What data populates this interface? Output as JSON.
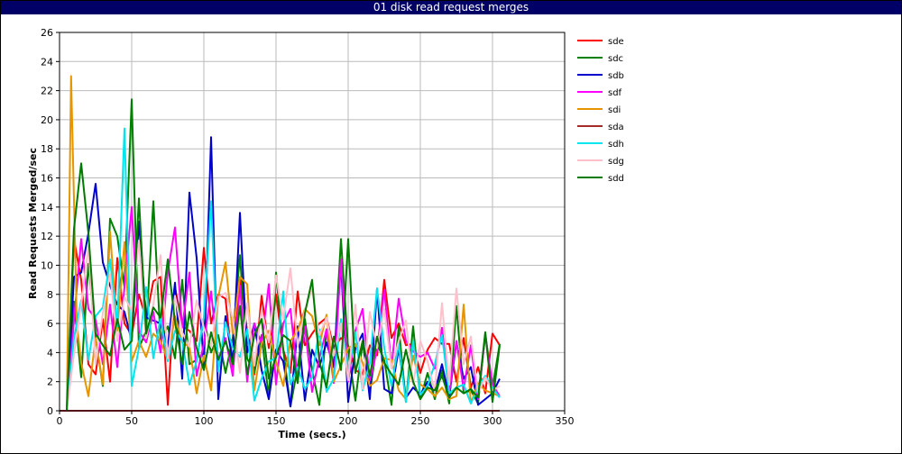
{
  "window": {
    "title": "01 disk read request merges"
  },
  "chart_data": {
    "type": "line",
    "title": "01 disk read request merges",
    "xlabel": "Time (secs.)",
    "ylabel": "Read Requests Merged/sec",
    "xlim": [
      0,
      350
    ],
    "ylim": [
      0,
      26
    ],
    "xticks": [
      0,
      50,
      100,
      150,
      200,
      250,
      300,
      350
    ],
    "yticks": [
      0,
      2,
      4,
      6,
      8,
      10,
      12,
      14,
      16,
      18,
      20,
      22,
      24,
      26
    ],
    "grid": true,
    "legend_position": "right",
    "series": [
      {
        "name": "sde",
        "color": "#ff0000",
        "x": [
          5,
          10,
          15,
          20,
          25,
          30,
          35,
          40,
          45,
          50,
          55,
          60,
          65,
          70,
          75,
          80,
          85,
          90,
          95,
          100,
          105,
          110,
          115,
          120,
          125,
          130,
          135,
          140,
          145,
          150,
          155,
          160,
          165,
          170,
          175,
          180,
          185,
          190,
          195,
          200,
          205,
          210,
          215,
          220,
          225,
          230,
          235,
          240,
          245,
          250,
          255,
          260,
          265,
          270,
          275,
          280,
          285,
          290,
          295,
          300,
          305
        ],
        "values": [
          0,
          11.8,
          9,
          3.2,
          2.5,
          6.3,
          2,
          10.5,
          6,
          5.2,
          8,
          6.3,
          8.9,
          9.2,
          0.4,
          8.5,
          5.8,
          5.5,
          4.8,
          11.2,
          6,
          8,
          7.7,
          3,
          9,
          5.5,
          2.5,
          7.9,
          4.3,
          8,
          4.2,
          2.6,
          8.2,
          4.5,
          5.3,
          6,
          6.4,
          4.3,
          5,
          4.5,
          2.8,
          2.5,
          4.5,
          3.8,
          9,
          5,
          6,
          4.5,
          4.6,
          2.6,
          4.2,
          5,
          4.6,
          4.6,
          2,
          5,
          1.6,
          3,
          1.2,
          5.3,
          4.5
        ]
      },
      {
        "name": "sdc",
        "color": "#008000",
        "x": [
          5,
          10,
          15,
          20,
          25,
          30,
          35,
          40,
          45,
          50,
          55,
          60,
          65,
          70,
          75,
          80,
          85,
          90,
          95,
          100,
          105,
          110,
          115,
          120,
          125,
          130,
          135,
          140,
          145,
          150,
          155,
          160,
          165,
          170,
          175,
          180,
          185,
          190,
          195,
          200,
          205,
          210,
          215,
          220,
          225,
          230,
          235,
          240,
          245,
          250,
          255,
          260,
          265,
          270,
          275,
          280,
          285,
          290,
          295,
          300,
          305
        ],
        "values": [
          0,
          7.5,
          2.3,
          10.1,
          5,
          1.7,
          13.2,
          12,
          8.5,
          21.4,
          4.3,
          5.5,
          14.4,
          4.8,
          5.8,
          3.6,
          9,
          3.2,
          3.5,
          6.3,
          4,
          5.2,
          2.6,
          5,
          10.7,
          3.6,
          2.6,
          5.2,
          0.9,
          9.5,
          4.2,
          0.3,
          3,
          6.3,
          2.8,
          0.4,
          5.6,
          3,
          11.8,
          4.2,
          0.7,
          4.7,
          1.3,
          4.6,
          3.5,
          0.4,
          5.8,
          0.6,
          5.8,
          0.8,
          2.6,
          0.8,
          2.8,
          0.5,
          7.2,
          1.2,
          1.4,
          0.5,
          5.3,
          1.6,
          4.6
        ]
      },
      {
        "name": "sdb",
        "color": "#0000cc",
        "x": [
          5,
          10,
          15,
          20,
          25,
          30,
          35,
          40,
          45,
          50,
          55,
          60,
          65,
          70,
          75,
          80,
          85,
          90,
          95,
          100,
          105,
          110,
          115,
          120,
          125,
          130,
          135,
          140,
          145,
          150,
          155,
          160,
          165,
          170,
          175,
          180,
          185,
          190,
          195,
          200,
          205,
          210,
          215,
          220,
          225,
          230,
          235,
          240,
          245,
          250,
          255,
          260,
          265,
          270,
          275,
          280,
          285,
          290,
          295,
          300,
          305
        ],
        "values": [
          0,
          9.2,
          9.5,
          12.2,
          15.6,
          10.2,
          8.6,
          7.3,
          6.8,
          4.8,
          13,
          6.4,
          6.2,
          6,
          4.4,
          8.8,
          2.2,
          15,
          10.5,
          3.1,
          18.8,
          0.8,
          6.5,
          3.3,
          13.6,
          4,
          6,
          2.8,
          0.8,
          4.2,
          3.4,
          0.3,
          5.8,
          0.7,
          4.2,
          3,
          4.7,
          3,
          10.1,
          0.6,
          4.3,
          5.3,
          0.8,
          8.4,
          1.5,
          1.2,
          4.3,
          0.9,
          1.6,
          1.1,
          2,
          1.3,
          3.2,
          1,
          4.7,
          2.2,
          3,
          0.4,
          0.8,
          1.2,
          2.2
        ]
      },
      {
        "name": "sdf",
        "color": "#ff00ff",
        "x": [
          5,
          10,
          15,
          20,
          25,
          30,
          35,
          40,
          45,
          50,
          55,
          60,
          65,
          70,
          75,
          80,
          85,
          90,
          95,
          100,
          105,
          110,
          115,
          120,
          125,
          130,
          135,
          140,
          145,
          150,
          155,
          160,
          165,
          170,
          175,
          180,
          185,
          190,
          195,
          200,
          205,
          210,
          215,
          220,
          225,
          230,
          235,
          240,
          245,
          250,
          255,
          260,
          265,
          270,
          275,
          280,
          285,
          290,
          295,
          300,
          305
        ],
        "values": [
          0,
          6.2,
          11.8,
          7,
          6.3,
          3.2,
          7.3,
          3,
          8.5,
          14,
          5.5,
          4.7,
          6.8,
          4,
          9.5,
          12.6,
          5.7,
          9.5,
          2.4,
          4.6,
          8.2,
          3.5,
          5,
          2.4,
          8.6,
          2,
          6,
          4.6,
          8.7,
          1.8,
          6,
          7,
          2.2,
          5.8,
          1.3,
          3.6,
          5.6,
          1.9,
          10.4,
          2,
          5.5,
          7,
          2.1,
          4.2,
          8.3,
          3,
          7.7,
          4.8,
          4.1,
          3.7,
          4,
          2.9,
          5.7,
          1.2,
          4.8,
          1.5,
          4.5,
          0.8,
          5.2,
          1.8,
          1
        ]
      },
      {
        "name": "sdi",
        "color": "#e69500",
        "x": [
          5,
          8,
          12,
          15,
          20,
          25,
          30,
          35,
          40,
          45,
          50,
          55,
          60,
          65,
          70,
          75,
          80,
          85,
          90,
          95,
          100,
          105,
          110,
          115,
          120,
          125,
          130,
          135,
          140,
          145,
          150,
          155,
          160,
          165,
          170,
          175,
          180,
          185,
          190,
          195,
          200,
          205,
          210,
          215,
          220,
          225,
          230,
          235,
          240,
          245,
          250,
          255,
          260,
          265,
          270,
          275,
          280,
          285,
          290,
          295,
          300,
          305
        ],
        "values": [
          0,
          23,
          6,
          3.3,
          1,
          5,
          1.8,
          12.3,
          5.5,
          11.6,
          3.4,
          4.8,
          3.7,
          5.3,
          4.8,
          3.5,
          6.5,
          4.7,
          4.4,
          1.2,
          3.8,
          1.4,
          7.8,
          10.2,
          5.3,
          9.2,
          8.7,
          1.4,
          4.6,
          5.5,
          3.4,
          1.7,
          4.8,
          5.5,
          7,
          6.5,
          4.5,
          6.6,
          2,
          3.1,
          4.3,
          4.6,
          3.3,
          1.7,
          2.1,
          3.6,
          3.5,
          1.4,
          0.8,
          3.8,
          1.8,
          1.5,
          1,
          1.6,
          0.8,
          1,
          7.3,
          0.5,
          1.9,
          1.4,
          1.2,
          1
        ]
      },
      {
        "name": "sda",
        "color": "#a52a2a",
        "x": [
          0,
          50,
          100,
          150,
          200,
          250,
          305
        ],
        "values": [
          0,
          0,
          0,
          0,
          0,
          0,
          0
        ]
      },
      {
        "name": "sdh",
        "color": "#00e5ee",
        "x": [
          5,
          10,
          15,
          20,
          25,
          30,
          35,
          40,
          45,
          50,
          55,
          60,
          65,
          70,
          75,
          80,
          85,
          90,
          95,
          100,
          105,
          110,
          115,
          120,
          125,
          130,
          135,
          140,
          145,
          150,
          155,
          160,
          165,
          170,
          175,
          180,
          185,
          190,
          195,
          200,
          205,
          210,
          215,
          220,
          225,
          230,
          235,
          240,
          245,
          250,
          255,
          260,
          265,
          270,
          275,
          280,
          285,
          290,
          295,
          300,
          305
        ],
        "values": [
          0,
          5,
          7.6,
          3.5,
          6.5,
          7.1,
          10.4,
          5.8,
          19.4,
          1.7,
          4.3,
          8.5,
          3.6,
          6.4,
          3.4,
          5.5,
          4.8,
          1.8,
          3.4,
          6.4,
          14.4,
          2.7,
          6.1,
          4.3,
          3.7,
          5.6,
          0.7,
          2.2,
          3.4,
          3.6,
          8.2,
          1.8,
          3,
          1.5,
          2.3,
          5.6,
          1.3,
          2.2,
          6.3,
          2.6,
          5.4,
          1.4,
          3.3,
          8.4,
          4.3,
          1.7,
          4.6,
          0.6,
          4.8,
          1.1,
          1.7,
          3.2,
          5.2,
          1.2,
          1.6,
          1.8,
          0.5,
          1.6,
          2.4,
          1.6,
          0.9
        ]
      },
      {
        "name": "sdg",
        "color": "#ffc0cb",
        "x": [
          5,
          10,
          15,
          20,
          25,
          30,
          35,
          40,
          45,
          50,
          55,
          60,
          65,
          70,
          75,
          80,
          85,
          90,
          95,
          100,
          105,
          110,
          115,
          120,
          125,
          130,
          135,
          140,
          145,
          150,
          155,
          160,
          165,
          170,
          175,
          180,
          185,
          190,
          195,
          200,
          205,
          210,
          215,
          220,
          225,
          230,
          235,
          240,
          245,
          250,
          255,
          260,
          265,
          270,
          275,
          280,
          285,
          290,
          295,
          300,
          305
        ],
        "values": [
          0,
          3.9,
          7.3,
          11.3,
          3.2,
          6.7,
          9.4,
          4.8,
          7.8,
          6.9,
          11.7,
          5,
          7.3,
          10.7,
          3.6,
          7.9,
          5.4,
          4.4,
          7.6,
          5.7,
          4.4,
          7.8,
          8.1,
          6.4,
          2.6,
          7.4,
          3.1,
          6.9,
          4.7,
          9.3,
          6.3,
          9.8,
          4.4,
          6.9,
          8.4,
          5.2,
          6.4,
          3.8,
          6,
          2.1,
          7.3,
          1.5,
          6.8,
          4.3,
          7,
          2.9,
          4.8,
          6.2,
          1.8,
          4.8,
          3.4,
          1.3,
          7.4,
          1.8,
          8.4,
          3.2,
          5.1,
          1.2,
          2.3,
          1.4,
          1.7
        ]
      },
      {
        "name": "sdd",
        "color": "#007a00",
        "x": [
          5,
          10,
          15,
          20,
          25,
          30,
          35,
          40,
          45,
          50,
          55,
          60,
          65,
          70,
          75,
          80,
          85,
          90,
          95,
          100,
          105,
          110,
          115,
          120,
          125,
          130,
          135,
          140,
          145,
          150,
          155,
          160,
          165,
          170,
          175,
          180,
          185,
          190,
          195,
          200,
          205,
          210,
          215,
          220,
          225,
          230,
          235,
          240,
          245,
          250,
          255,
          260,
          265,
          270,
          275,
          280,
          285,
          290,
          295,
          300,
          305
        ],
        "values": [
          0,
          12.5,
          17,
          12.2,
          5.3,
          4.5,
          3.8,
          6.3,
          4.2,
          4.8,
          14.6,
          5.3,
          7.1,
          6.4,
          10.4,
          6.1,
          3.2,
          6.8,
          4.3,
          2.8,
          5.4,
          3.5,
          4.8,
          3.2,
          7.2,
          2.5,
          5.2,
          6.3,
          2.2,
          3.7,
          5.2,
          4.8,
          1.9,
          6.7,
          9,
          3.4,
          1.6,
          5.1,
          2.8,
          11.8,
          2.6,
          4.8,
          2.4,
          5.1,
          3.3,
          2.5,
          1.8,
          4.2,
          2,
          0.8,
          1.6,
          1.4,
          2.4,
          0.9,
          1.6,
          1.2,
          1.5,
          0.9,
          5.4,
          0.6,
          4.5
        ]
      }
    ]
  }
}
